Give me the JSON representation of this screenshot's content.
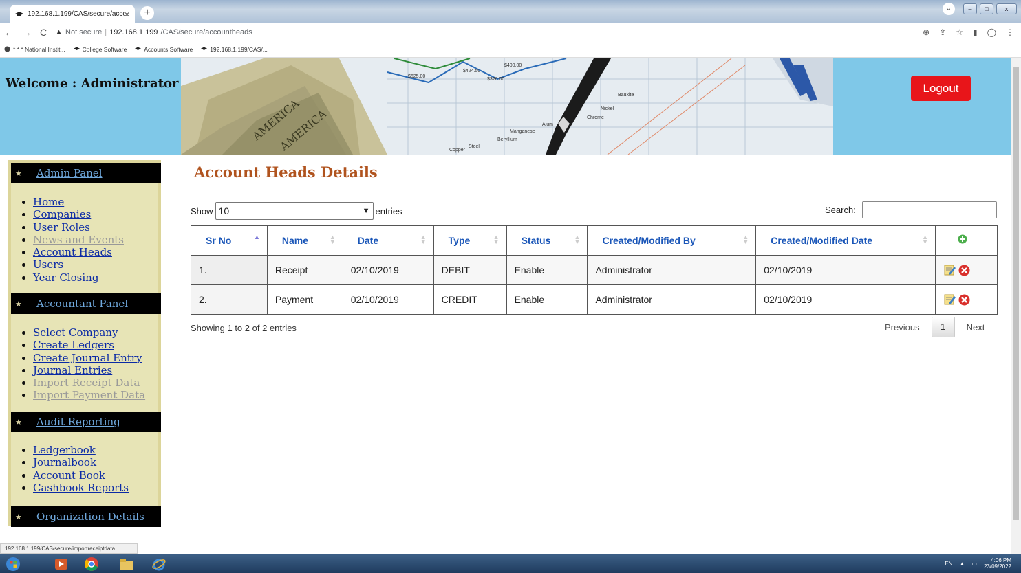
{
  "browser": {
    "tab_title": "192.168.1.199/CAS/secure/accou",
    "not_secure": "Not secure",
    "url_host": "192.168.1.199",
    "url_path": "/CAS/secure/accountheads",
    "bookmarks": [
      "* * * National Instit...",
      "College Software",
      "Accounts Software",
      "192.168.1.199/CAS/..."
    ],
    "status_url": "192.168.1.199/CAS/secure/importreceiptdata"
  },
  "header": {
    "welcome": "Welcome : Administrator",
    "logout": "Logout",
    "banner_labels": [
      "$625.00",
      "$424.50",
      "$326.00",
      "$400.00",
      "Nickel",
      "Bauxite",
      "Chrome",
      "Beryllium",
      "Manganese",
      "Copper",
      "Steel",
      "Alum",
      "AMERICA",
      "AMERICA"
    ]
  },
  "sidebar": {
    "panels": [
      {
        "title": "Admin Panel",
        "items": [
          {
            "label": "Home",
            "enabled": true
          },
          {
            "label": "Companies",
            "enabled": true
          },
          {
            "label": "User Roles",
            "enabled": true
          },
          {
            "label": "News and Events",
            "enabled": false
          },
          {
            "label": "Account Heads",
            "enabled": true
          },
          {
            "label": "Users",
            "enabled": true
          },
          {
            "label": "Year Closing",
            "enabled": true
          }
        ]
      },
      {
        "title": "Accountant Panel",
        "items": [
          {
            "label": "Select Company",
            "enabled": true
          },
          {
            "label": "Create Ledgers",
            "enabled": true
          },
          {
            "label": "Create Journal Entry",
            "enabled": true
          },
          {
            "label": "Journal Entries",
            "enabled": true
          },
          {
            "label": "Import Receipt Data",
            "enabled": false
          },
          {
            "label": "Import Payment Data",
            "enabled": false
          }
        ]
      },
      {
        "title": "Audit Reporting",
        "items": [
          {
            "label": "Ledgerbook",
            "enabled": true
          },
          {
            "label": "Journalbook",
            "enabled": true
          },
          {
            "label": "Account Book",
            "enabled": true
          },
          {
            "label": "Cashbook Reports",
            "enabled": true
          }
        ]
      },
      {
        "title": "Organization Details",
        "items": []
      }
    ]
  },
  "main": {
    "title": "Account Heads Details",
    "show_label": "Show",
    "entries_value": "10",
    "entries_label": "entries",
    "search_label": "Search:",
    "columns": [
      "Sr No",
      "Name",
      "Date",
      "Type",
      "Status",
      "Created/Modified By",
      "Created/Modified Date"
    ],
    "rows": [
      [
        "1.",
        "Receipt",
        "02/10/2019",
        "DEBIT",
        "Enable",
        "Administrator",
        "02/10/2019"
      ],
      [
        "2.",
        "Payment",
        "02/10/2019",
        "CREDIT",
        "Enable",
        "Administrator",
        "02/10/2019"
      ]
    ],
    "info": "Showing 1 to 2 of 2 entries",
    "previous": "Previous",
    "page": "1",
    "next": "Next"
  },
  "taskbar": {
    "lang": "EN",
    "time": "4:06 PM",
    "date": "23/09/2022"
  }
}
